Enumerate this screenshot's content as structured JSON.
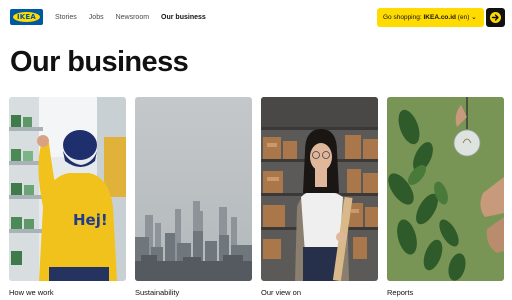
{
  "brand": {
    "logo_text": "IKEA",
    "blue": "#0058a3",
    "yellow": "#ffdb00"
  },
  "nav": {
    "items": [
      {
        "label": "Stories"
      },
      {
        "label": "Jobs"
      },
      {
        "label": "Newsroom"
      },
      {
        "label": "Our business",
        "active": true
      }
    ]
  },
  "shop": {
    "prefix": "Go shopping: ",
    "site": "IKEA.co.id",
    "suffix": " (en)",
    "dropdown_icon": "chevron-down-icon",
    "go_icon": "arrow-right-icon"
  },
  "page": {
    "title": "Our business"
  },
  "cards": [
    {
      "label": "How we work",
      "image": "worker in yellow Hej! uniform in store"
    },
    {
      "label": "Sustainability",
      "image": "hazy city skyline"
    },
    {
      "label": "Our view on",
      "image": "woman holding wooden plank"
    },
    {
      "label": "Reports",
      "image": "hand holding light bulb with plants"
    }
  ]
}
